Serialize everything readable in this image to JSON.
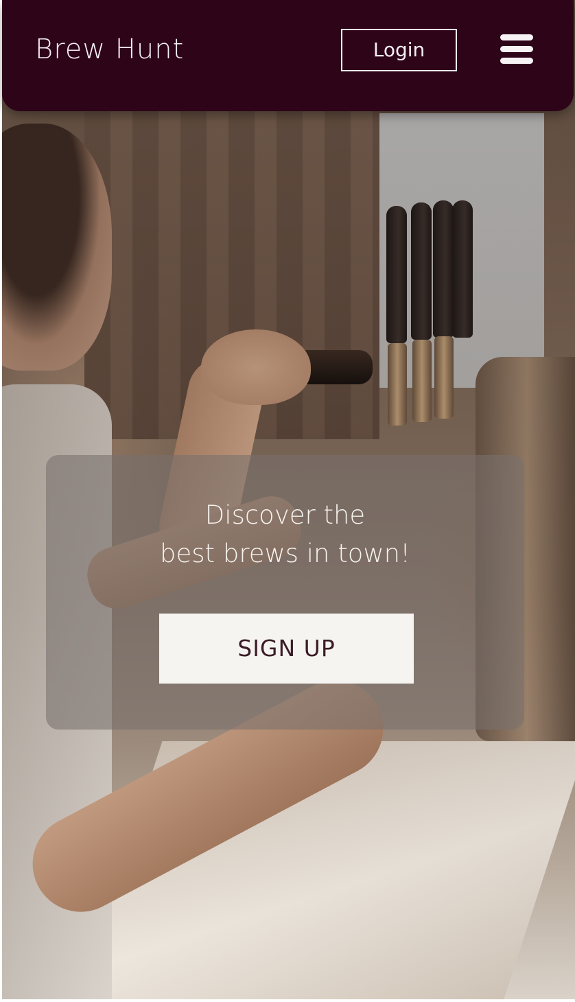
{
  "header": {
    "brand": "Brew Hunt",
    "login_label": "Login",
    "menu_icon": "hamburger-menu-icon"
  },
  "hero": {
    "image": "bartender-pulling-beer-tap-photo",
    "headline_line1": "Discover the",
    "headline_line2": "best brews in town!",
    "signup_label": "SIGN UP"
  },
  "colors": {
    "header_bg": "#2e0419",
    "header_text": "#f3eef2",
    "button_bg": "#f6f4f0",
    "button_text": "#3a1c27"
  }
}
